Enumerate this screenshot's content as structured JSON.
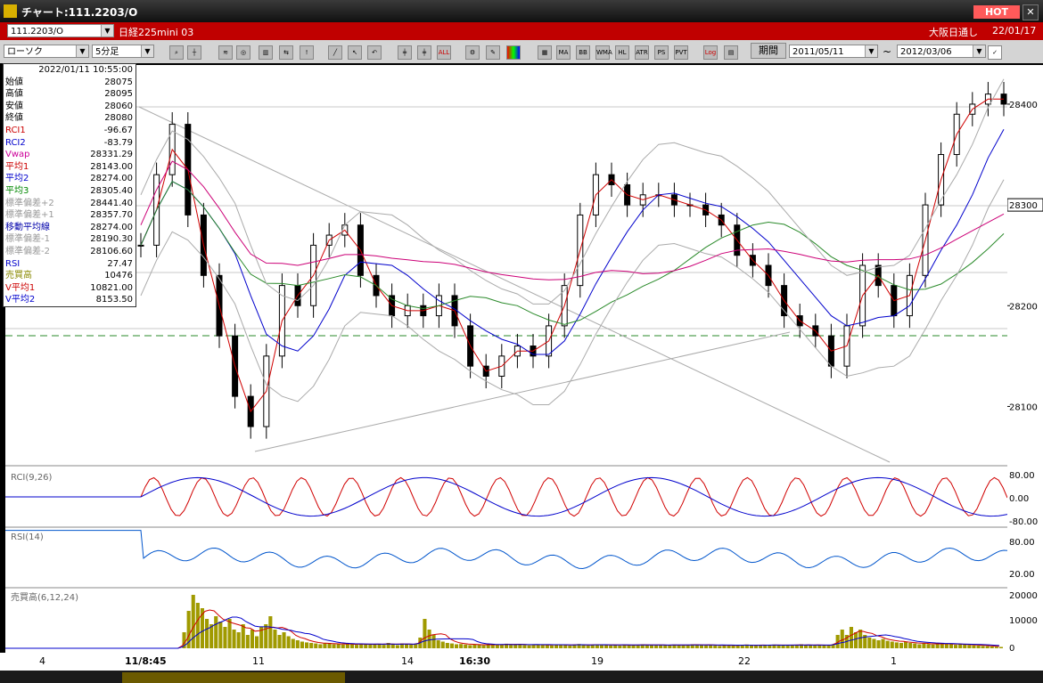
{
  "window": {
    "title": "チャート:111.2203/O",
    "hot_label": "HOT"
  },
  "symbol_bar": {
    "symbol": "111.2203/O",
    "name": "日経225mini 03",
    "session": "大阪日通し",
    "date": "22/01/17"
  },
  "toolbar": {
    "chart_type": "ローソク",
    "period": "5分足",
    "period_button": "期間",
    "date_from": "2011/05/11",
    "date_to": "2012/03/06",
    "tilde": "~",
    "buttons": [
      "ALL",
      "MA",
      "BB",
      "WMA",
      "HL",
      "ATR",
      "PS",
      "PVT",
      "Log"
    ]
  },
  "info": {
    "datetime": "2022/01/11 10:55:00",
    "rows": [
      {
        "label": "始値",
        "value": "28075",
        "color": "#000000"
      },
      {
        "label": "高値",
        "value": "28095",
        "color": "#000000"
      },
      {
        "label": "安値",
        "value": "28060",
        "color": "#000000"
      },
      {
        "label": "終値",
        "value": "28080",
        "color": "#000000"
      },
      {
        "label": "RCI1",
        "value": "-96.67",
        "color": "#cc0000"
      },
      {
        "label": "RCI2",
        "value": "-83.79",
        "color": "#0000cc"
      },
      {
        "label": "Vwap",
        "value": "28331.29",
        "color": "#cc0099"
      },
      {
        "label": "平均1",
        "value": "28143.00",
        "color": "#cc0000"
      },
      {
        "label": "平均2",
        "value": "28274.00",
        "color": "#0000cc"
      },
      {
        "label": "平均3",
        "value": "28305.40",
        "color": "#008800"
      },
      {
        "label": "標準偏差+2",
        "value": "28441.40",
        "color": "#999999"
      },
      {
        "label": "標準偏差+1",
        "value": "28357.70",
        "color": "#999999"
      },
      {
        "label": "移動平均線",
        "value": "28274.00",
        "color": "#0000aa"
      },
      {
        "label": "標準偏差-1",
        "value": "28190.30",
        "color": "#999999"
      },
      {
        "label": "標準偏差-2",
        "value": "28106.60",
        "color": "#999999"
      },
      {
        "label": "RSI",
        "value": "27.47",
        "color": "#0000cc"
      },
      {
        "label": "売買高",
        "value": "10476",
        "color": "#888800"
      },
      {
        "label": "V平均1",
        "value": "10821.00",
        "color": "#cc0000"
      },
      {
        "label": "V平均2",
        "value": "8153.50",
        "color": "#0000cc"
      }
    ]
  },
  "panels": {
    "rci_label": "RCI(9,26)",
    "rsi_label": "RSI(14)",
    "vol_label": "売買高(6,12,24)"
  },
  "x_labels": [
    "4",
    "11/8:45",
    "11",
    "14",
    "16:30",
    "19",
    "22",
    "1"
  ],
  "chart_data": [
    {
      "type": "line",
      "panel": "price",
      "y_ticks": [
        28100,
        28200,
        28300,
        28400
      ],
      "current_price": 28300,
      "ylim": [
        28050,
        28430
      ],
      "candles_close": [
        28260,
        28330,
        28380,
        28290,
        28230,
        28170,
        28110,
        28080,
        28150,
        28220,
        28200,
        28260,
        28270,
        28280,
        28230,
        28210,
        28190,
        28200,
        28190,
        28210,
        28180,
        28140,
        28130,
        28150,
        28160,
        28150,
        28180,
        28220,
        28290,
        28330,
        28320,
        28300,
        28310,
        28310,
        28300,
        28300,
        28290,
        28280,
        28250,
        28240,
        28220,
        28190,
        28180,
        28170,
        28140,
        28180,
        28240,
        28220,
        28190,
        28230,
        28300,
        28350,
        28390,
        28400,
        28410,
        28400
      ]
    },
    {
      "type": "line",
      "panel": "rci",
      "y_ticks": [
        "80.00",
        "0.00",
        "-80.00"
      ]
    },
    {
      "type": "line",
      "panel": "rsi",
      "y_ticks": [
        "80.00",
        "20.00"
      ]
    },
    {
      "type": "bar",
      "panel": "volume",
      "y_ticks": [
        "20000",
        "10000",
        "0"
      ],
      "values": [
        0,
        0,
        0,
        0,
        0,
        0,
        0,
        0,
        0,
        0,
        0,
        0,
        0,
        0,
        0,
        0,
        0,
        0,
        0,
        0,
        0,
        0,
        0,
        0,
        0,
        0,
        0,
        0,
        0,
        0,
        0,
        0,
        0,
        0,
        0,
        0,
        0,
        0,
        0,
        6000,
        14000,
        20000,
        17000,
        15000,
        11000,
        9000,
        12000,
        10000,
        8000,
        11000,
        7000,
        6000,
        9000,
        5000,
        7000,
        4500,
        8000,
        9000,
        12000,
        7000,
        5000,
        6000,
        4500,
        3500,
        3000,
        2500,
        2200,
        2000,
        1800,
        1500,
        1800,
        2000,
        1500,
        1600,
        1400,
        1700,
        1500,
        1300,
        1800,
        1600,
        1400,
        1500,
        1700,
        1300,
        2000,
        1500,
        1200,
        1800,
        1600,
        1400,
        1500,
        4000,
        11000,
        7000,
        5000,
        3000,
        2500,
        2000,
        1800,
        1500,
        1600,
        1400,
        1200,
        1500,
        1300,
        1100,
        1400,
        1600,
        1200,
        1500,
        1700,
        1300,
        1400,
        1600,
        1200,
        1100,
        1500,
        1300,
        1200,
        1400,
        1100,
        1300,
        1500,
        1200,
        1000,
        1400,
        1600,
        1300,
        1100,
        1200,
        1400,
        1500,
        1300,
        1100,
        1200,
        1000,
        1400,
        1300,
        1200,
        1100,
        1500,
        1300,
        1200,
        1100,
        1300,
        1200,
        1000,
        1400,
        1300,
        1100,
        1200,
        1500,
        1400,
        1300,
        1100,
        1200,
        1000,
        900,
        1300,
        1200,
        1100,
        1000,
        1200,
        1400,
        1100,
        1000,
        1300,
        1200,
        1100,
        1400,
        1300,
        1000,
        1200,
        1100,
        1300,
        1500,
        1200,
        1100,
        1000,
        1300,
        1200,
        1100,
        1400,
        5000,
        7000,
        5000,
        8000,
        6000,
        7000,
        5000,
        4000,
        3500,
        3000,
        3500,
        2800,
        2500,
        2200,
        2000,
        2500,
        2000,
        1800,
        1500,
        1800,
        1600,
        1400,
        2000,
        1800,
        1500,
        1600,
        1300,
        1500,
        1400,
        1200,
        1100,
        1000,
        900,
        800,
        700,
        600,
        500
      ]
    }
  ]
}
